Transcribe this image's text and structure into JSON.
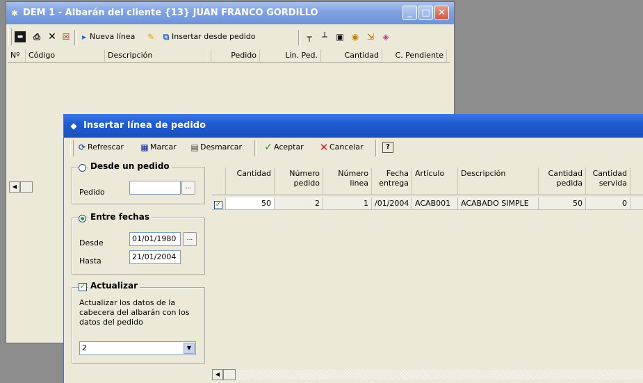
{
  "back_window": {
    "title": "DEM 1 - Albarán del cliente  {13} JUAN FRANCO GORDILLO",
    "toolbar": {
      "nueva_linea": "Nueva línea",
      "insertar_desde_pedido": "Insertar desde pedido"
    },
    "columns": [
      "Nº",
      "Código",
      "Descripción",
      "Pedido",
      "Lin. Ped.",
      "Cantidad",
      "C. Pendiente"
    ]
  },
  "dialog": {
    "title": "Insertar línea de pedido",
    "toolbar": {
      "refrescar": "Refrescar",
      "marcar": "Marcar",
      "desmarcar": "Desmarcar",
      "aceptar": "Aceptar",
      "cancelar": "Cancelar"
    },
    "desde_pedido": {
      "legend": "Desde  un pedido",
      "pedido_label": "Pedido",
      "pedido_value": ""
    },
    "entre_fechas": {
      "legend": "Entre fechas",
      "desde_label": "Desde",
      "desde_value": "01/01/1980",
      "hasta_label": "Hasta",
      "hasta_value": "21/01/2004"
    },
    "actualizar": {
      "legend": "Actualizar",
      "description": "Actualizar los datos de la cabecera del albarán con los datos del pedido",
      "select_value": "2"
    },
    "grid": {
      "columns": [
        "Cantidad",
        "Número pedido",
        "Número linea",
        "Fecha entrega",
        "Artículo",
        "Descripción",
        "Cantidad pedida",
        "Cantidad servida"
      ],
      "rows": [
        {
          "checked": true,
          "cantidad": "50",
          "numero_pedido": "2",
          "numero_linea": "1",
          "fecha_entrega": "/01/2004",
          "articulo": "ACAB001",
          "descripcion": "ACABADO SIMPLE",
          "cantidad_pedida": "50",
          "cantidad_servida": "0"
        }
      ]
    }
  }
}
